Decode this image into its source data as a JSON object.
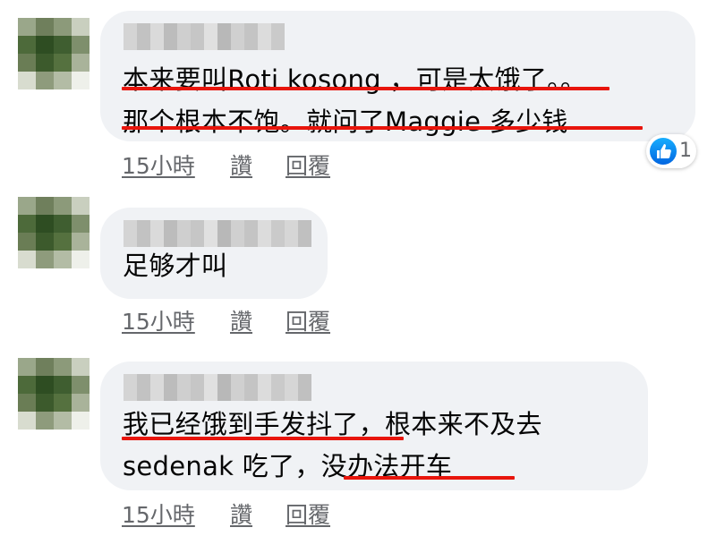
{
  "colors": {
    "bubble": "#f0f2f5",
    "underline": "#e8150c",
    "meta": "#65676b",
    "like_blue": "#0866ff"
  },
  "comments": [
    {
      "lines": [
        "本来要叫Roti kosong ，可是太饿了。。",
        "那个根本不饱。就问了Maggie 多少钱"
      ],
      "time": "15小時",
      "like_label": "讚",
      "reply_label": "回覆",
      "reaction_count": "1",
      "reaction_icon": "thumbs-up-icon"
    },
    {
      "lines": [
        "足够才叫"
      ],
      "time": "15小時",
      "like_label": "讚",
      "reply_label": "回覆"
    },
    {
      "lines": [
        "我已经饿到手发抖了，根本来不及去",
        "sedenak 吃了，没办法开车"
      ],
      "time": "15小時",
      "like_label": "讚",
      "reply_label": "回覆"
    }
  ]
}
